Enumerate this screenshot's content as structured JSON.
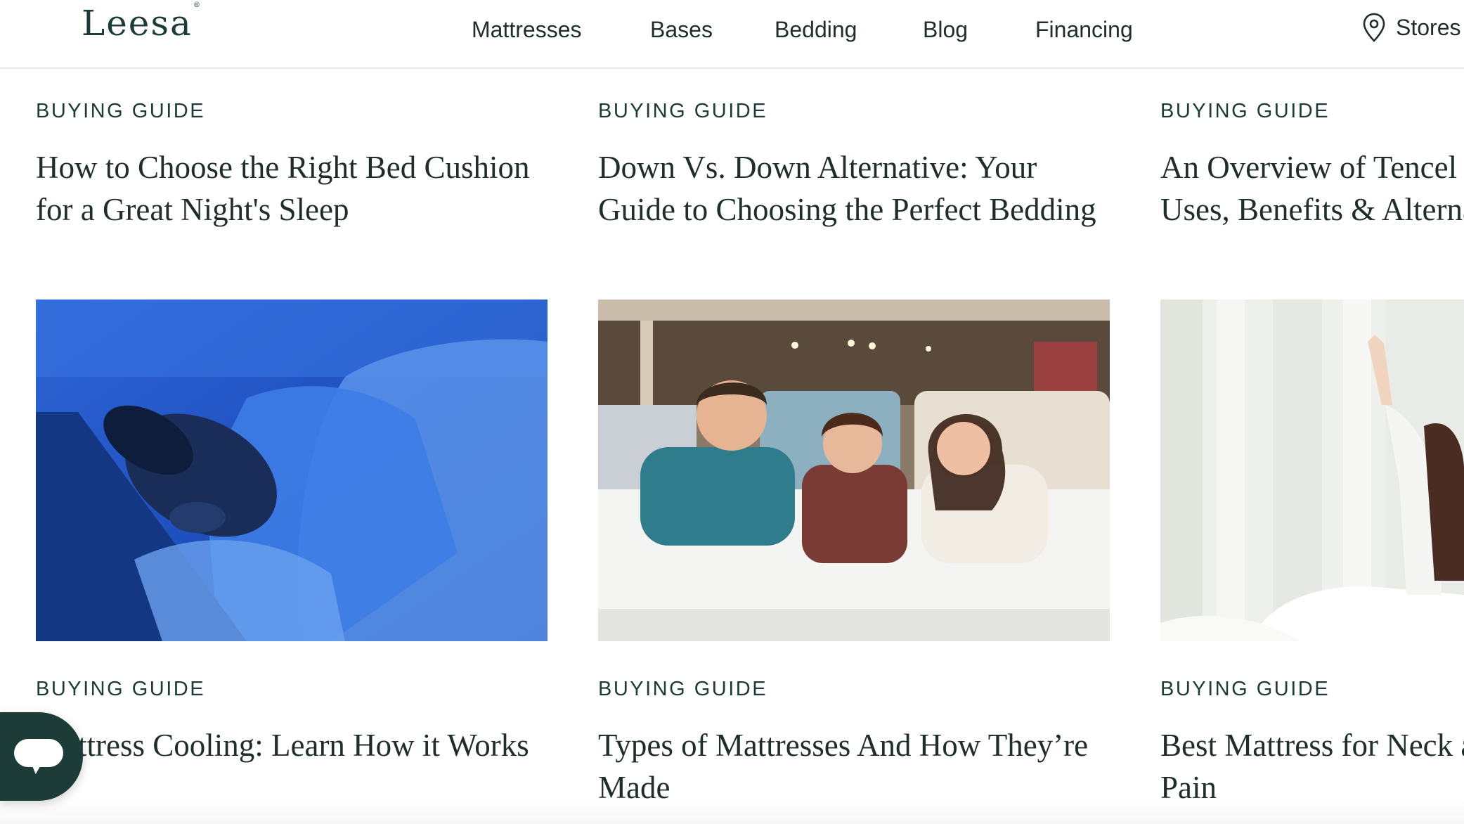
{
  "header": {
    "logo": "Leesa",
    "logo_mark": "®",
    "nav": [
      "Mattresses",
      "Bases",
      "Bedding",
      "Blog",
      "Financing"
    ],
    "stores_label": "Stores",
    "stores_icon": "map-pin-icon"
  },
  "articles": [
    {
      "category": "BUYING GUIDE",
      "title_lines": [
        "How to Choose the Right Bed Cushion",
        "for a Great Night's Sleep"
      ]
    },
    {
      "category": "BUYING GUIDE",
      "title_lines": [
        "Down Vs. Down Alternative: Your",
        "Guide to Choosing the Perfect Bedding"
      ]
    },
    {
      "category": "BUYING GUIDE",
      "title_lines": [
        "An Overview of Tencel",
        "Uses, Benefits & Alterna"
      ]
    },
    {
      "category": "BUYING GUIDE",
      "title_lines": [
        "ttress Cooling: Learn How it Works"
      ]
    },
    {
      "category": "BUYING GUIDE",
      "title_lines": [
        "Types of Mattresses And How They’re",
        "Made"
      ]
    },
    {
      "category": "BUYING GUIDE",
      "title_lines": [
        "Best Mattress for Neck a",
        "Pain"
      ]
    }
  ],
  "images": [
    {
      "icon": "sleeping-man-photo"
    },
    {
      "icon": "family-on-mattress-photo"
    },
    {
      "icon": "woman-stretching-photo"
    }
  ],
  "chat": {
    "icon": "chat-bubble-icon"
  },
  "colors": {
    "brand": "#1d3c37",
    "text": "#1f2e2b",
    "divider": "#e6e6e6"
  }
}
